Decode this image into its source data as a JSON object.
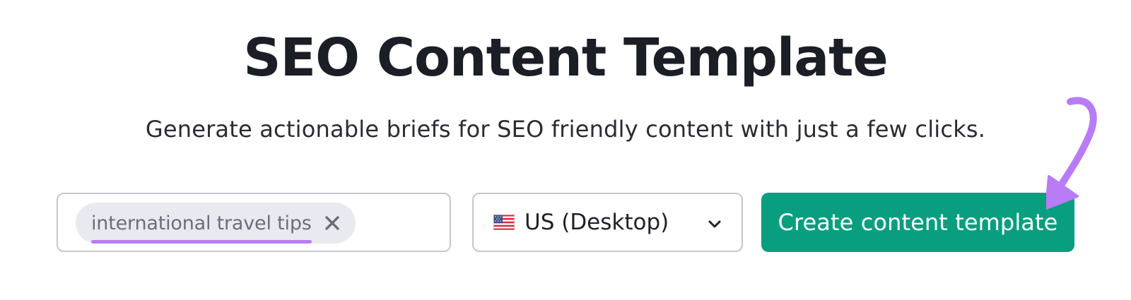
{
  "page": {
    "title": "SEO Content Template",
    "subtitle": "Generate actionable briefs for SEO friendly content with just a few clicks."
  },
  "keyword_input": {
    "chip_text": "international travel tips",
    "chip_remove_icon": "close-icon"
  },
  "database_select": {
    "flag_icon": "us-flag-icon",
    "selected_label": "US (Desktop)",
    "dropdown_icon": "chevron-down-icon"
  },
  "actions": {
    "create_label": "Create content template"
  },
  "colors": {
    "primary_button": "#089e7f",
    "annotation_highlight": "#b77cf6",
    "chip_background": "#e9eaef",
    "border": "#c5c7d0",
    "title_text": "#1c1e26"
  }
}
